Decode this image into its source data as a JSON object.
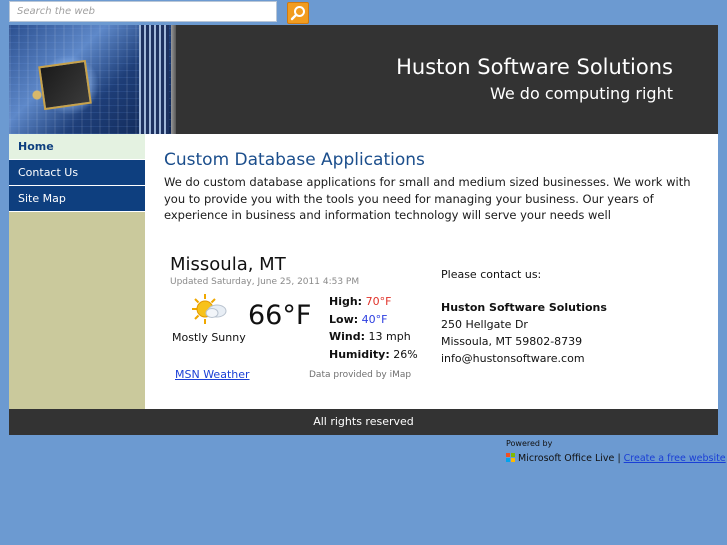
{
  "search": {
    "placeholder": "Search the web",
    "button_icon": "search-icon"
  },
  "header": {
    "title": "Huston Software Solutions",
    "tagline": "We do computing right"
  },
  "nav": {
    "items": [
      {
        "label": "Home",
        "active": true
      },
      {
        "label": "Contact Us",
        "active": false
      },
      {
        "label": "Site Map",
        "active": false
      }
    ]
  },
  "main": {
    "title": "Custom Database Applications",
    "text": "We do custom database applications for small and medium sized businesses. We work with you to provide you with the tools you need for managing your business.  Our years of experience in business and information technology will serve your needs well"
  },
  "weather": {
    "city": "Missoula, MT",
    "updated": "Updated Saturday, June 25, 2011 4:53 PM",
    "icon": "partly-sunny-icon",
    "condition": "Mostly Sunny",
    "temperature": "66°F",
    "high_label": "High:",
    "high_value": "70°F",
    "low_label": "Low:",
    "low_value": "40°F",
    "wind_label": "Wind:",
    "wind_value": "13 mph",
    "humidity_label": "Humidity:",
    "humidity_value": "26%",
    "link": "MSN Weather",
    "credit": "Data provided by iMap"
  },
  "contact": {
    "prompt": "Please contact us:",
    "company": "Huston Software Solutions",
    "street": "250 Hellgate Dr",
    "city_line": "Missoula, MT  59802-8739",
    "email": "info@hustonsoftware.com"
  },
  "footer": {
    "text": "All rights reserved"
  },
  "powered": {
    "label": "Powered by",
    "brand": "Microsoft Office Live",
    "separator": "|",
    "link": "Create a free website"
  },
  "colors": {
    "background": "#6c9ad1",
    "header": "#333333",
    "nav": "#0e3f7f",
    "nav_active": "#e4f2e1",
    "sidebar": "#cac99c",
    "title": "#1b4e8c",
    "high_temp": "#e0332a",
    "low_temp": "#2c3ee0",
    "search_button": "#f19c20"
  }
}
